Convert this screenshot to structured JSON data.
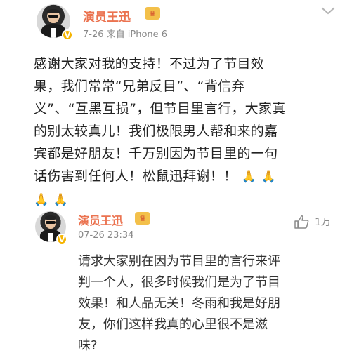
{
  "post": {
    "author": "演员王迅",
    "meta": "7-26  来自 iPhone 6",
    "verified_badge": "V",
    "text_line1": "感谢大家对我的支持！不过为了节目效",
    "text_line2": "果，我们常常“兄弟反目”、“背信弃",
    "text_line3": "义”、“互黑互损”，但节目里言行，大家真",
    "text_line4": "的别太较真儿！我们极限男人帮和来的嘉",
    "text_line5": "宾都是好朋友！千万别因为节目里的一句",
    "text_line6": "话伤害到任何人！松鼠迅拜谢！！",
    "emoji": "🙏"
  },
  "comment": {
    "author": "演员王迅",
    "time": "07-26 23:34",
    "like_count": "1万",
    "text_line1": "请求大家别在因为节目里的言行来评",
    "text_line2": "判一个人，很多时候我们是为了节目",
    "text_line3": "效果！和人品无关！冬雨和我是好朋",
    "text_line4": "友，你们这样我真的心里很不是滋",
    "text_line5": "味?"
  },
  "colors": {
    "name": "#eb7350",
    "meta": "#888888",
    "text": "#222222",
    "badge": "#f5b400"
  },
  "icons": {
    "menu": "chevron-down-icon",
    "like": "thumbs-up-icon",
    "member": "crown-badge-icon",
    "verified": "verified-v-icon"
  }
}
